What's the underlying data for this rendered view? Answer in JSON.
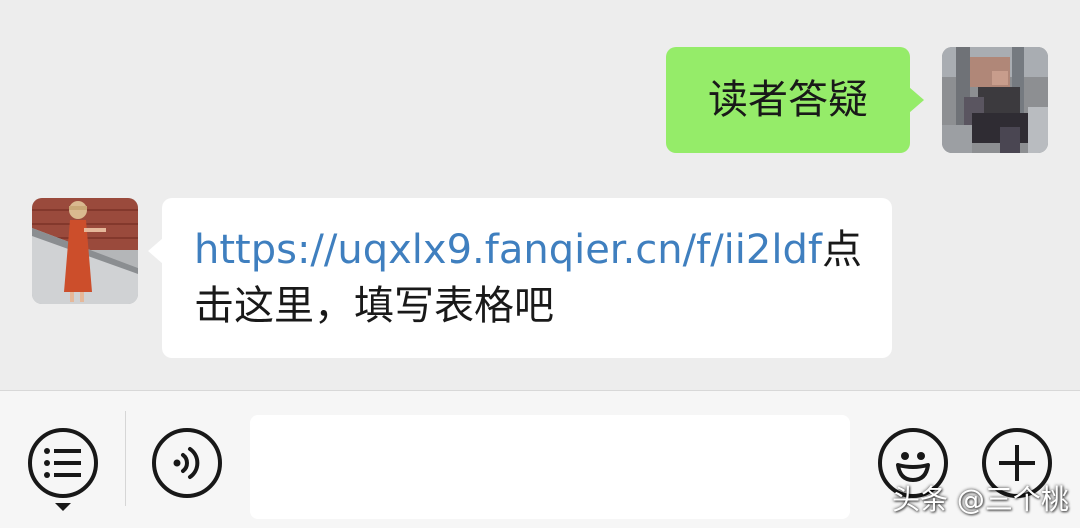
{
  "messages": [
    {
      "direction": "outgoing",
      "text": "读者答疑"
    },
    {
      "direction": "incoming",
      "link": "https://uqxlx9.fanqier.cn/f/ii2ldf",
      "text_line1": "点",
      "text_line2": "击这里，填写表格吧"
    }
  ],
  "toolbar": {
    "menu_icon": "list-menu-icon",
    "voice_icon": "voice-input-icon",
    "emoji_icon": "emoji-icon",
    "plus_icon": "plus-icon",
    "input_value": ""
  },
  "watermark": "头条 @三个桃",
  "colors": {
    "chat_background": "#ededed",
    "outgoing_bubble": "#95ec69",
    "incoming_bubble": "#ffffff",
    "link": "#3f7fbf",
    "toolbar_background": "#f6f6f6"
  }
}
